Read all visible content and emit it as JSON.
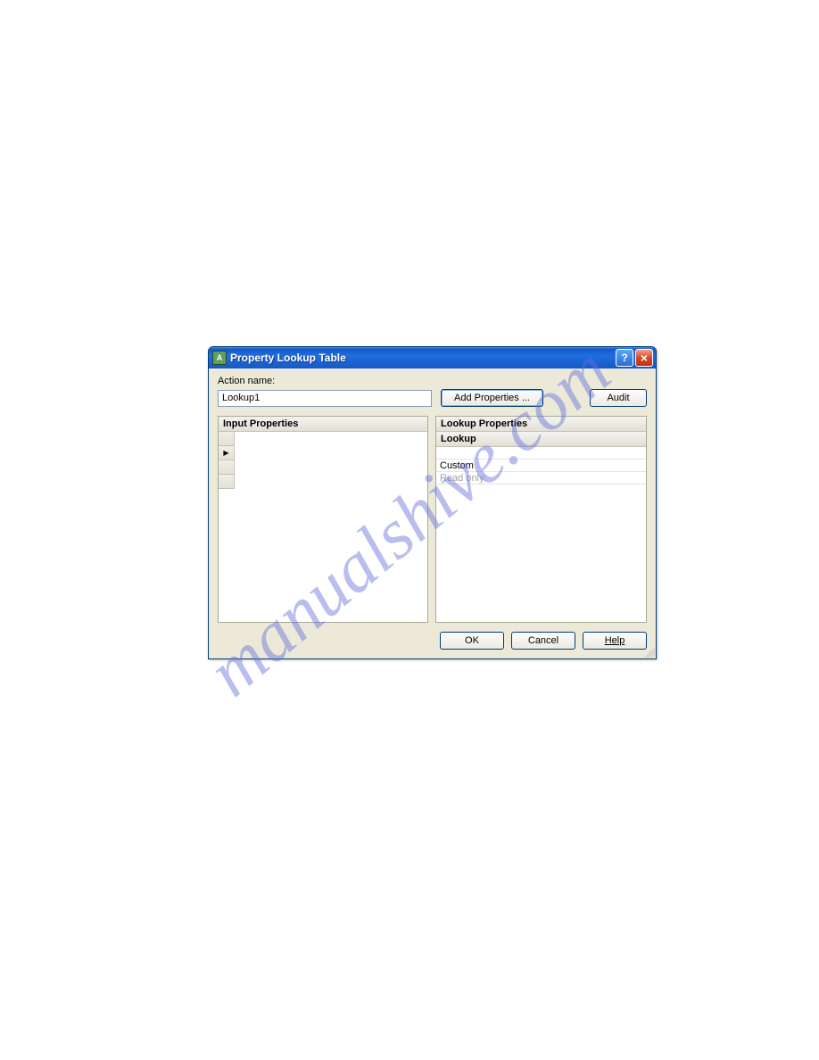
{
  "watermark": "manualshive.com",
  "dialog": {
    "icon_letter": "A",
    "title": "Property Lookup Table",
    "action_label": "Action name:",
    "action_value": "Lookup1",
    "add_properties_btn": "Add Properties ...",
    "audit_btn": "Audit",
    "input_panel_header": "Input Properties",
    "lookup_panel_header": "Lookup Properties",
    "lookup_column_header": "Lookup",
    "lookup_rows": {
      "custom": "Custom",
      "readonly": "Read only"
    },
    "buttons": {
      "ok": "OK",
      "cancel": "Cancel",
      "help": "Help"
    }
  }
}
